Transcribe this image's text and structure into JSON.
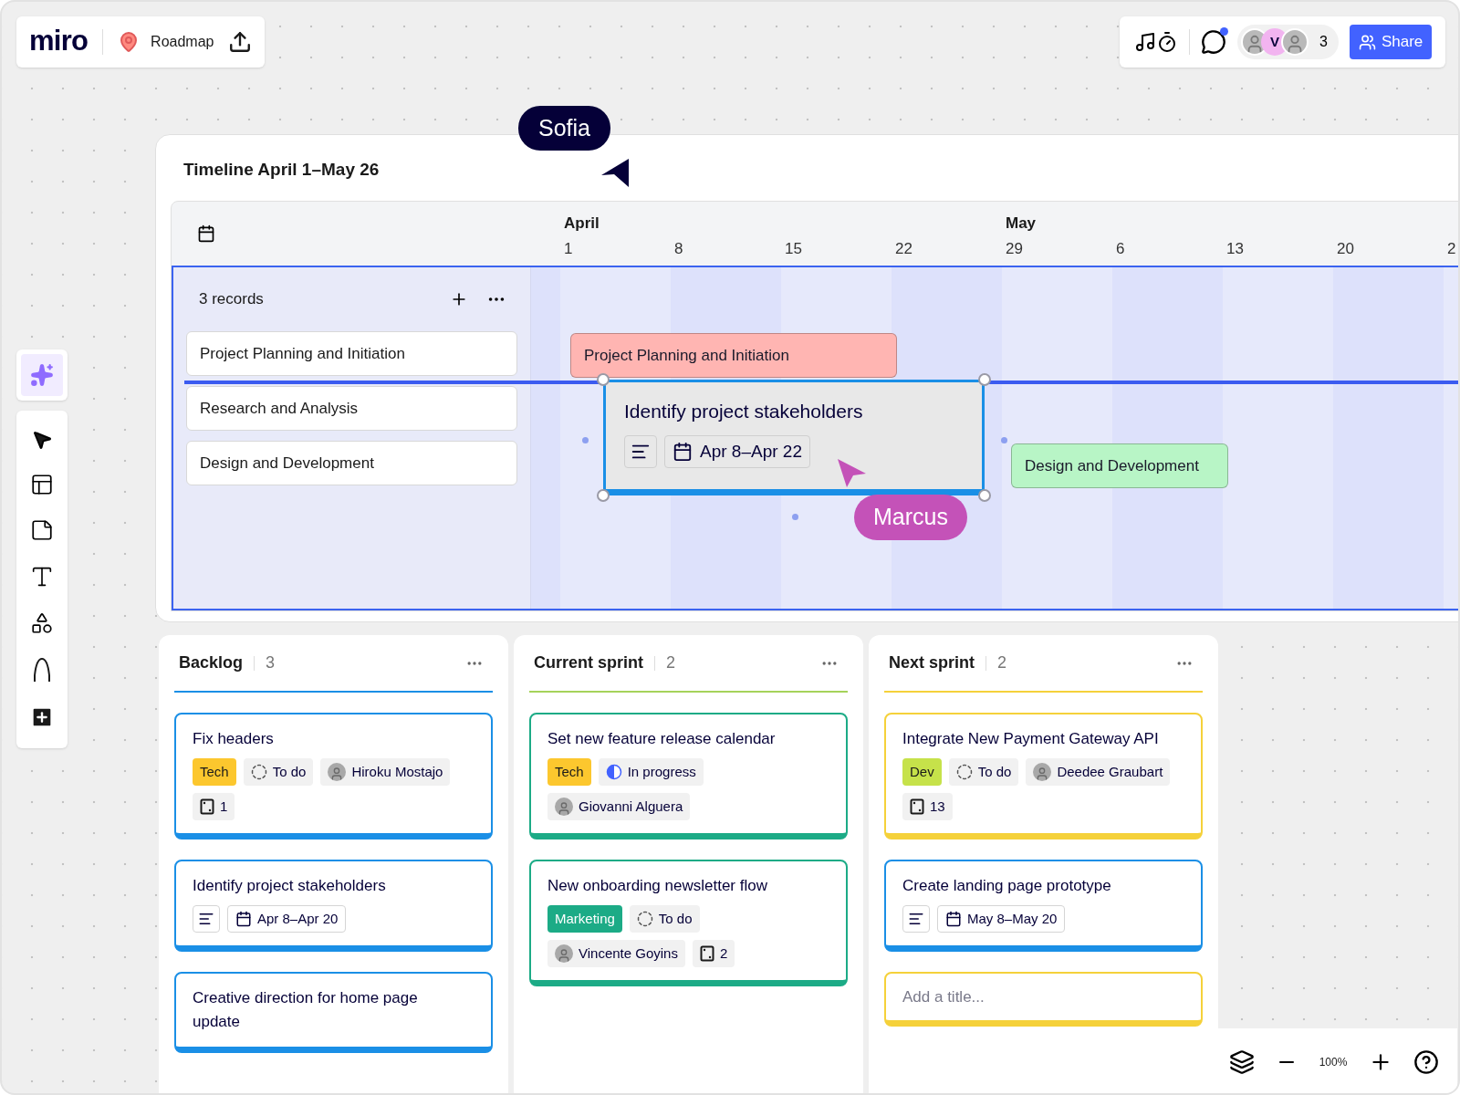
{
  "board": {
    "logo": "miro",
    "name": "Roadmap"
  },
  "collaborators": {
    "notification": true,
    "avatars": [
      {
        "kind": "photo"
      },
      {
        "kind": "initial",
        "text": "V",
        "color": "#f2b4f0"
      },
      {
        "kind": "photo"
      }
    ],
    "count": "3",
    "share": "Share"
  },
  "cursors": [
    {
      "name": "Sofia",
      "color": "#050038"
    },
    {
      "name": "Marcus",
      "color": "#c452b8"
    }
  ],
  "timeline": {
    "title": "Timeline April 1–May 26",
    "records": "3 records",
    "days": [
      {
        "label": "1",
        "month": "April"
      },
      {
        "label": "8"
      },
      {
        "label": "15"
      },
      {
        "label": "22"
      },
      {
        "label": "29",
        "month": "May"
      },
      {
        "label": "6"
      },
      {
        "label": "13"
      },
      {
        "label": "20"
      },
      {
        "label": "2"
      }
    ],
    "rows": [
      "Project Planning and Initiation",
      "Research and Analysis",
      "Design and Development"
    ],
    "bars": [
      {
        "kind": "bar",
        "label": "Project Planning and Initiation",
        "color": "#ffb5b2",
        "selected": false
      },
      {
        "kind": "card",
        "label": "Identify project stakeholders",
        "date": "Apr 8–Apr 22",
        "selected": true
      },
      {
        "kind": "bar",
        "label": "Design and Development",
        "color": "#b8f5c6",
        "selected": false
      }
    ]
  },
  "columns": [
    {
      "title": "Backlog",
      "count": "3",
      "color": "#1a8fe6",
      "cards": [
        {
          "title": "Fix headers",
          "color": "#1a8fe6",
          "tags": [
            {
              "kind": "label",
              "text": "Tech",
              "color": "#fcc72e"
            },
            {
              "kind": "todo",
              "text": "To do"
            },
            {
              "kind": "person",
              "text": "Hiroku Mostajo"
            },
            {
              "kind": "points",
              "text": "1"
            }
          ]
        },
        {
          "title": "Identify project stakeholders",
          "color": "#1a8fe6",
          "tags": [
            {
              "kind": "notes"
            },
            {
              "kind": "date",
              "text": "Apr 8–Apr 20"
            }
          ]
        },
        {
          "title": "Creative direction for home page update",
          "color": "#1a8fe6"
        }
      ]
    },
    {
      "title": "Current sprint",
      "count": "2",
      "color": "#a5d35a",
      "cards": [
        {
          "title": "Set new feature release calendar",
          "color": "#1cab86",
          "tags": [
            {
              "kind": "label",
              "text": "Tech",
              "color": "#fcc72e"
            },
            {
              "kind": "progress",
              "text": "In progress"
            },
            {
              "kind": "person",
              "text": "Giovanni Alguera"
            }
          ]
        },
        {
          "title": "New onboarding newsletter flow",
          "color": "#1cab86",
          "tags": [
            {
              "kind": "label",
              "text": "Marketing",
              "color": "#1cab86"
            },
            {
              "kind": "todo",
              "text": "To do"
            },
            {
              "kind": "person",
              "text": "Vincente Goyins"
            },
            {
              "kind": "points",
              "text": "2"
            }
          ]
        }
      ]
    },
    {
      "title": "Next sprint",
      "count": "2",
      "color": "#f5d13a",
      "new_card": {
        "placeholder": "Add a title...",
        "color": "#f5d13a"
      },
      "cards": [
        {
          "title": "Integrate New Payment Gateway API",
          "color": "#f5d13a",
          "tags": [
            {
              "kind": "label",
              "text": "Dev",
              "color": "#c6e24a"
            },
            {
              "kind": "todo",
              "text": "To do"
            },
            {
              "kind": "person",
              "text": "Deedee Graubart"
            },
            {
              "kind": "points",
              "text": "13"
            }
          ]
        },
        {
          "title": "Create landing page prototype",
          "color": "#1a8fe6",
          "tags": [
            {
              "kind": "notes"
            },
            {
              "kind": "date",
              "text": "May 8–May 20"
            }
          ]
        }
      ]
    }
  ],
  "zoom": {
    "value": "100%"
  }
}
